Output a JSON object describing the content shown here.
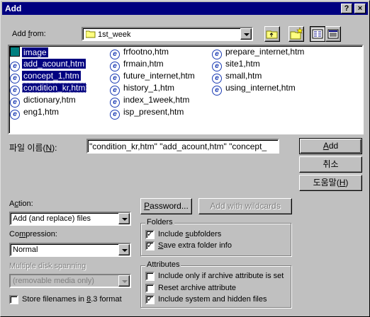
{
  "title": "Add",
  "title_buttons": {
    "help": "?",
    "close": "×"
  },
  "add_from": {
    "label_pre": "Add ",
    "label_key": "f",
    "label_post": "rom:",
    "folder": "1st_week"
  },
  "files": [
    {
      "name": "image",
      "selected": true
    },
    {
      "name": "add_acount,htm",
      "selected": true
    },
    {
      "name": "concept_1,htm",
      "selected": true
    },
    {
      "name": "condition_kr,htm",
      "selected": true
    },
    {
      "name": "dictionary,htm",
      "selected": false
    },
    {
      "name": "eng1,htm",
      "selected": false
    },
    {
      "name": "frfootno,htm",
      "selected": false
    },
    {
      "name": "frmain,htm",
      "selected": false
    },
    {
      "name": "future_internet,htm",
      "selected": false
    },
    {
      "name": "history_1,htm",
      "selected": false
    },
    {
      "name": "index_1week,htm",
      "selected": false
    },
    {
      "name": "isp_present,htm",
      "selected": false
    },
    {
      "name": "prepare_internet,htm",
      "selected": false
    },
    {
      "name": "site1,htm",
      "selected": false
    },
    {
      "name": "small,htm",
      "selected": false
    },
    {
      "name": "using_internet,htm",
      "selected": false
    }
  ],
  "filename": {
    "label_pre": "파일 이름(",
    "label_key": "N",
    "label_post": "):",
    "value": "\"condition_kr,htm\" \"add_acount,htm\" \"concept_"
  },
  "buttons": {
    "add_key": "A",
    "add_rest": "dd",
    "cancel": "취소",
    "help_pre": "도움말(",
    "help_key": "H",
    "help_post": ")",
    "password_key": "P",
    "password_rest": "assword...",
    "add_wildcards": "Add with wildcards"
  },
  "action": {
    "label_pre": "A",
    "label_key": "c",
    "label_post": "tion:",
    "value": "Add (and replace) files"
  },
  "compression": {
    "label_pre": "Co",
    "label_key": "m",
    "label_post": "pression:",
    "value": "Normal"
  },
  "spanning": {
    "label": "Multiple disk spanning",
    "value": "(removable media only)"
  },
  "store83": {
    "pre": "Store filenames in ",
    "key": "8",
    "post": ".3 format",
    "checked": false
  },
  "folders": {
    "title": "Folders",
    "include_subfolders": {
      "pre": "Include ",
      "key": "s",
      "post": "ubfolders",
      "checked": true
    },
    "save_extra": {
      "key": "S",
      "post": "ave extra folder info",
      "checked": true
    }
  },
  "attributes": {
    "title": "Attributes",
    "only_archive": {
      "label": "Include only if archive attribute is set",
      "checked": false
    },
    "reset_archive": {
      "label": "Reset archive attribute",
      "checked": false
    },
    "system_hidden": {
      "label": "Include system and hidden files",
      "checked": true
    }
  },
  "colors": {
    "titlebar": "#000080",
    "face": "#c0c0c0",
    "selection": "#000080"
  }
}
